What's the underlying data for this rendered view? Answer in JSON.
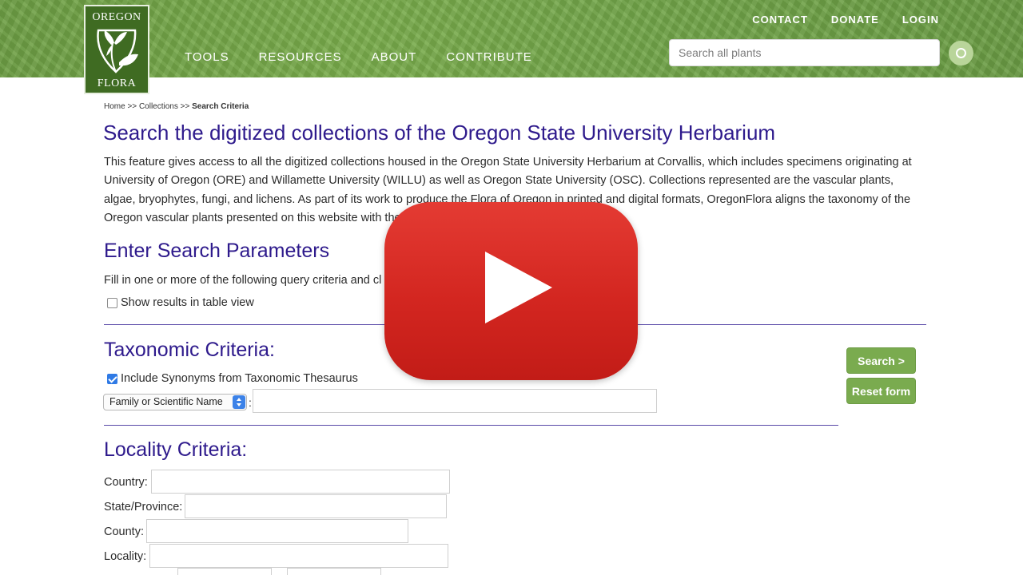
{
  "header": {
    "logo": {
      "top_text": "OREGON",
      "bottom_text": "FLORA"
    },
    "main_nav": [
      "TOOLS",
      "RESOURCES",
      "ABOUT",
      "CONTRIBUTE"
    ],
    "top_nav": [
      "CONTACT",
      "DONATE",
      "LOGIN"
    ],
    "search": {
      "placeholder": "Search all plants"
    }
  },
  "breadcrumb": {
    "home": "Home",
    "sep": ">>",
    "collections": "Collections",
    "current": "Search Criteria"
  },
  "page_title": "Search the digitized collections of the Oregon State University Herbarium",
  "intro_text": "This feature gives access to all the digitized collections housed in the Oregon State University Herbarium at Corvallis, which includes specimens originating at University of Oregon (ORE) and Willamette University (WILLU) as well as Oregon State University (OSC). Collections represented are the vascular plants, algae, bryophytes, fungi, and lichens. As part of its work to produce the Flora of Oregon in printed and digital formats, OregonFlora aligns the taxonomy of the Oregon vascular plants presented on this website with the Flora o",
  "search_params": {
    "heading": "Enter Search Parameters",
    "instructions": "Fill in one or more of the following query criteria and cl",
    "table_view_label": "Show results in table view"
  },
  "taxonomic": {
    "heading": "Taxonomic Criteria:",
    "synonyms_label": "Include Synonyms from Taxonomic Thesaurus",
    "select_value": "Family or Scientific Name",
    "colon": ":"
  },
  "buttons": {
    "search": "Search >",
    "reset": "Reset form"
  },
  "locality": {
    "heading": "Locality Criteria:",
    "country_label": "Country:",
    "state_label": "State/Province:",
    "county_label": "County:",
    "locality_label": "Locality:"
  },
  "colors": {
    "accent": "#2e1a8c",
    "button_green": "#7aab4f",
    "header_green": "#74a74a",
    "play_red": "#d32620"
  },
  "icons": {
    "play": "play-icon",
    "search": "search-icon"
  }
}
